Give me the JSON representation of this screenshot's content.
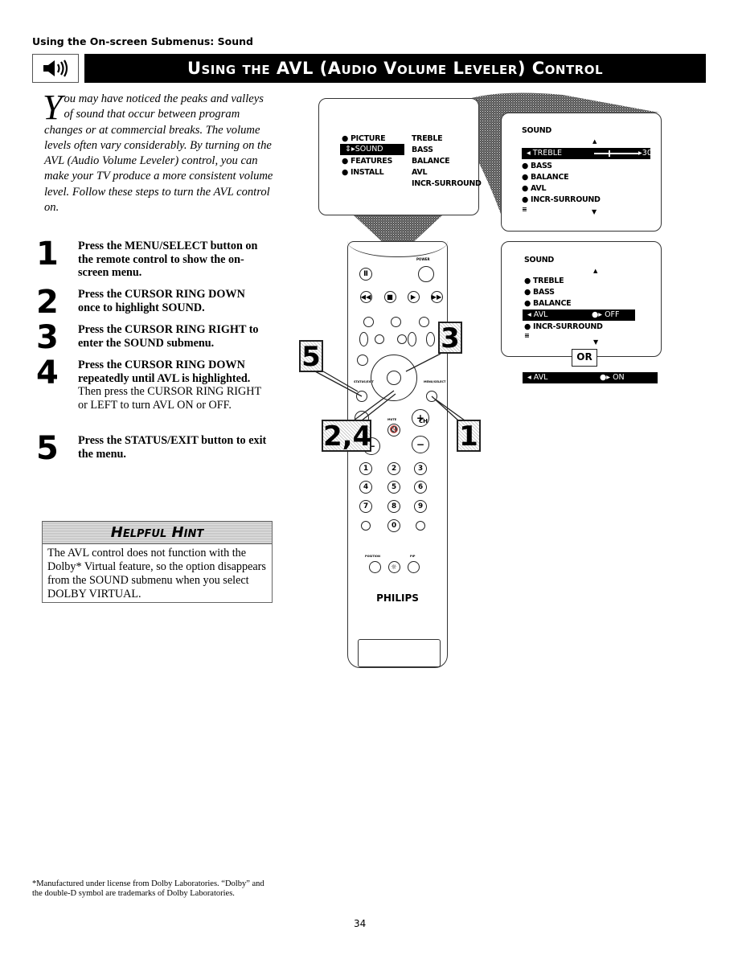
{
  "section_header": "Using the On-screen Submenus: Sound",
  "title": "Using the AVL (Audio Volume Leveler) Control",
  "icon": "speaker-icon",
  "intro": {
    "dropcap": "Y",
    "text": "ou may have noticed the peaks and valleys of sound that occur between program changes or at commercial breaks. The volume levels often vary considerably. By turning on the AVL (Audio Volume Leveler) control, you can make your TV produce a more consistent volume level. Follow these steps to turn the AVL control on."
  },
  "steps": [
    {
      "num": "1",
      "bold": "Press the MENU/SELECT button on the remote control to show the on-screen menu.",
      "text": ""
    },
    {
      "num": "2",
      "bold": "Press the CURSOR RING DOWN once to highlight SOUND.",
      "text": ""
    },
    {
      "num": "3",
      "bold": "Press the CURSOR RING RIGHT to enter the SOUND submenu.",
      "text": ""
    },
    {
      "num": "4",
      "bold": "Press the CURSOR RING DOWN repeatedly until AVL is highlighted.",
      "text": " Then press the CURSOR RING RIGHT or LEFT to turn AVL ON or OFF."
    },
    {
      "num": "5",
      "bold": "Press the STATUS/EXIT button to exit the menu.",
      "text": ""
    }
  ],
  "hint": {
    "title": "Helpful Hint",
    "text": "The AVL control does not function with the Dolby* Virtual feature, so the option disappears from the SOUND submenu when you select DOLBY VIRTUAL."
  },
  "menu_main": {
    "left": [
      "PICTURE",
      "SOUND",
      "FEATURES",
      "INSTALL"
    ],
    "selected": "SOUND",
    "right": [
      "TREBLE",
      "BASS",
      "BALANCE",
      "AVL",
      "INCR-SURROUND"
    ]
  },
  "menu_sound1": {
    "title": "SOUND",
    "selected": "TREBLE",
    "value": "30",
    "items": [
      "BASS",
      "BALANCE",
      "AVL",
      "INCR-SURROUND"
    ]
  },
  "menu_sound2": {
    "title": "SOUND",
    "items_before": [
      "TREBLE",
      "BASS",
      "BALANCE"
    ],
    "selected": "AVL",
    "selected_value": "OFF",
    "items_after": [
      "INCR-SURROUND"
    ]
  },
  "or_label": "OR",
  "avl_on": {
    "label": "AVL",
    "value": "ON"
  },
  "remote": {
    "brand": "PHILIPS",
    "power_label": "POWER",
    "mute_label": "MUTE",
    "ch_label": "CH",
    "status_label": "STATUS/EXIT",
    "menu_label": "MENU/SELECT",
    "position_label": "POSITION",
    "pip_label": "PIP",
    "digits": [
      "1",
      "2",
      "3",
      "4",
      "5",
      "6",
      "7",
      "8",
      "9",
      "0"
    ]
  },
  "callouts": [
    "5",
    "3",
    "2,4",
    "1"
  ],
  "footnote": "*Manufactured under license from Dolby Laboratories. “Dolby” and the double-D symbol are trademarks of Dolby Laboratories.",
  "page_number": "34"
}
